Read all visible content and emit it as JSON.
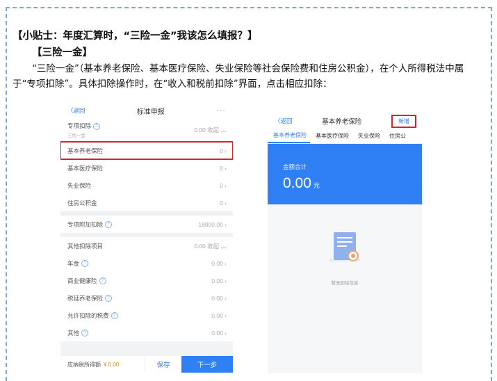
{
  "tip_title": "【小贴士：年度汇算时，“三险一金”我该怎么填报？】",
  "sub_title": "【三险一金】",
  "paragraph": "“三险一金”（基本养老保险、基本医疗保险、失业保险等社会保险费和住房公积金），在个人所得税法中属于“专项扣除”。具体扣除操作时，在“收入和税前扣除”界面，点击相应扣除：",
  "screen1": {
    "back": "〈返回",
    "title": "标准申报",
    "more": "···",
    "special": {
      "label": "专项扣除",
      "sub": "三险一金",
      "value": "0.00 收起 ︿"
    },
    "items": [
      {
        "label": "基本养老保险",
        "value": "0 ›"
      },
      {
        "label": "基本医疗保险",
        "value": "0 ›"
      },
      {
        "label": "失业保险",
        "value": "0 ›"
      },
      {
        "label": "住房公积金",
        "value": "0 ›"
      }
    ],
    "additional": {
      "label": "专项附加扣除",
      "value": "18000.00 ›"
    },
    "other": {
      "label": "其他扣除项目",
      "value": "0.00 收起 ︿"
    },
    "other_items": [
      {
        "label": "年金",
        "value": "0.00 ›"
      },
      {
        "label": "商业健康险",
        "value": "0.00 ›"
      },
      {
        "label": "税延养老保险",
        "value": "0.00 ›"
      },
      {
        "label": "允许扣除的税费",
        "value": "0.00 ›"
      },
      {
        "label": "其他",
        "value": "0.00 ›"
      }
    ],
    "bottom": {
      "tax_label": "应纳税所得额",
      "tax_value": "¥ 0.00",
      "save": "保存",
      "next": "下一步"
    }
  },
  "screen2": {
    "back": "〈返回",
    "title": "基本养老保险",
    "add": "新增",
    "tabs": [
      "基本养老保险",
      "基本医疗保险",
      "失业保险",
      "住房公"
    ],
    "total_label": "金额合计",
    "total_value": "0.00",
    "unit": "元",
    "empty_text": "暂无扣除信息"
  },
  "colors": {
    "accent": "#2f7ff5",
    "highlight": "#d0262d",
    "border": "#7ea6d6"
  }
}
